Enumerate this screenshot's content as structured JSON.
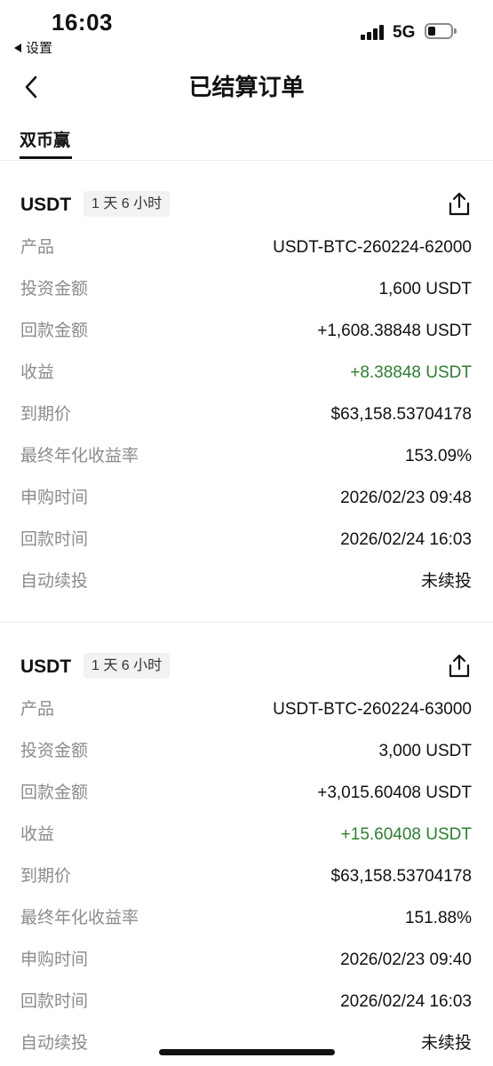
{
  "status_bar": {
    "time": "16:03",
    "back_label": "设置",
    "network": "5G",
    "battery_level": 0.35
  },
  "nav": {
    "title": "已结算订单"
  },
  "tabs": [
    {
      "label": "双币赢",
      "active": true
    }
  ],
  "orders": [
    {
      "asset": "USDT",
      "duration": "1 天 6 小时",
      "rows": [
        {
          "label": "产品",
          "value": "USDT-BTC-260224-62000"
        },
        {
          "label": "投资金额",
          "value": "1,600 USDT"
        },
        {
          "label": "回款金额",
          "value": "+1,608.38848 USDT"
        },
        {
          "label": "收益",
          "value": "+8.38848 USDT"
        },
        {
          "label": "到期价",
          "value": "$63,158.53704178"
        },
        {
          "label": "最终年化收益率",
          "value": "153.09%"
        },
        {
          "label": "申购时间",
          "value": "2026/02/23 09:48"
        },
        {
          "label": "回款时间",
          "value": "2026/02/24 16:03"
        },
        {
          "label": "自动续投",
          "value": "未续投"
        }
      ]
    },
    {
      "asset": "USDT",
      "duration": "1 天 6 小时",
      "rows": [
        {
          "label": "产品",
          "value": "USDT-BTC-260224-63000"
        },
        {
          "label": "投资金额",
          "value": "3,000 USDT"
        },
        {
          "label": "回款金额",
          "value": "+3,015.60408 USDT"
        },
        {
          "label": "收益",
          "value": "+15.60408 USDT"
        },
        {
          "label": "到期价",
          "value": "$63,158.53704178"
        },
        {
          "label": "最终年化收益率",
          "value": "151.88%"
        },
        {
          "label": "申购时间",
          "value": "2026/02/23 09:40"
        },
        {
          "label": "回款时间",
          "value": "2026/02/24 16:03"
        },
        {
          "label": "自动续投",
          "value": "未续投"
        }
      ]
    }
  ],
  "colors": {
    "profit": "#2e7d32",
    "label": "#8c8c8c",
    "text": "#111111",
    "badge_bg": "#f2f2f2"
  },
  "icons": {
    "share": "share-icon",
    "back": "chevron-left-icon"
  }
}
